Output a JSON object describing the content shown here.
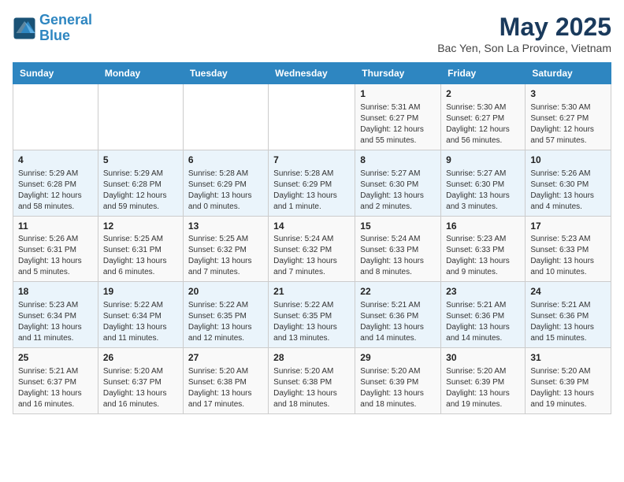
{
  "header": {
    "logo_line1": "General",
    "logo_line2": "Blue",
    "title": "May 2025",
    "subtitle": "Bac Yen, Son La Province, Vietnam"
  },
  "days_of_week": [
    "Sunday",
    "Monday",
    "Tuesday",
    "Wednesday",
    "Thursday",
    "Friday",
    "Saturday"
  ],
  "weeks": [
    [
      {
        "num": "",
        "info": ""
      },
      {
        "num": "",
        "info": ""
      },
      {
        "num": "",
        "info": ""
      },
      {
        "num": "",
        "info": ""
      },
      {
        "num": "1",
        "info": "Sunrise: 5:31 AM\nSunset: 6:27 PM\nDaylight: 12 hours\nand 55 minutes."
      },
      {
        "num": "2",
        "info": "Sunrise: 5:30 AM\nSunset: 6:27 PM\nDaylight: 12 hours\nand 56 minutes."
      },
      {
        "num": "3",
        "info": "Sunrise: 5:30 AM\nSunset: 6:27 PM\nDaylight: 12 hours\nand 57 minutes."
      }
    ],
    [
      {
        "num": "4",
        "info": "Sunrise: 5:29 AM\nSunset: 6:28 PM\nDaylight: 12 hours\nand 58 minutes."
      },
      {
        "num": "5",
        "info": "Sunrise: 5:29 AM\nSunset: 6:28 PM\nDaylight: 12 hours\nand 59 minutes."
      },
      {
        "num": "6",
        "info": "Sunrise: 5:28 AM\nSunset: 6:29 PM\nDaylight: 13 hours\nand 0 minutes."
      },
      {
        "num": "7",
        "info": "Sunrise: 5:28 AM\nSunset: 6:29 PM\nDaylight: 13 hours\nand 1 minute."
      },
      {
        "num": "8",
        "info": "Sunrise: 5:27 AM\nSunset: 6:30 PM\nDaylight: 13 hours\nand 2 minutes."
      },
      {
        "num": "9",
        "info": "Sunrise: 5:27 AM\nSunset: 6:30 PM\nDaylight: 13 hours\nand 3 minutes."
      },
      {
        "num": "10",
        "info": "Sunrise: 5:26 AM\nSunset: 6:30 PM\nDaylight: 13 hours\nand 4 minutes."
      }
    ],
    [
      {
        "num": "11",
        "info": "Sunrise: 5:26 AM\nSunset: 6:31 PM\nDaylight: 13 hours\nand 5 minutes."
      },
      {
        "num": "12",
        "info": "Sunrise: 5:25 AM\nSunset: 6:31 PM\nDaylight: 13 hours\nand 6 minutes."
      },
      {
        "num": "13",
        "info": "Sunrise: 5:25 AM\nSunset: 6:32 PM\nDaylight: 13 hours\nand 7 minutes."
      },
      {
        "num": "14",
        "info": "Sunrise: 5:24 AM\nSunset: 6:32 PM\nDaylight: 13 hours\nand 7 minutes."
      },
      {
        "num": "15",
        "info": "Sunrise: 5:24 AM\nSunset: 6:33 PM\nDaylight: 13 hours\nand 8 minutes."
      },
      {
        "num": "16",
        "info": "Sunrise: 5:23 AM\nSunset: 6:33 PM\nDaylight: 13 hours\nand 9 minutes."
      },
      {
        "num": "17",
        "info": "Sunrise: 5:23 AM\nSunset: 6:33 PM\nDaylight: 13 hours\nand 10 minutes."
      }
    ],
    [
      {
        "num": "18",
        "info": "Sunrise: 5:23 AM\nSunset: 6:34 PM\nDaylight: 13 hours\nand 11 minutes."
      },
      {
        "num": "19",
        "info": "Sunrise: 5:22 AM\nSunset: 6:34 PM\nDaylight: 13 hours\nand 11 minutes."
      },
      {
        "num": "20",
        "info": "Sunrise: 5:22 AM\nSunset: 6:35 PM\nDaylight: 13 hours\nand 12 minutes."
      },
      {
        "num": "21",
        "info": "Sunrise: 5:22 AM\nSunset: 6:35 PM\nDaylight: 13 hours\nand 13 minutes."
      },
      {
        "num": "22",
        "info": "Sunrise: 5:21 AM\nSunset: 6:36 PM\nDaylight: 13 hours\nand 14 minutes."
      },
      {
        "num": "23",
        "info": "Sunrise: 5:21 AM\nSunset: 6:36 PM\nDaylight: 13 hours\nand 14 minutes."
      },
      {
        "num": "24",
        "info": "Sunrise: 5:21 AM\nSunset: 6:36 PM\nDaylight: 13 hours\nand 15 minutes."
      }
    ],
    [
      {
        "num": "25",
        "info": "Sunrise: 5:21 AM\nSunset: 6:37 PM\nDaylight: 13 hours\nand 16 minutes."
      },
      {
        "num": "26",
        "info": "Sunrise: 5:20 AM\nSunset: 6:37 PM\nDaylight: 13 hours\nand 16 minutes."
      },
      {
        "num": "27",
        "info": "Sunrise: 5:20 AM\nSunset: 6:38 PM\nDaylight: 13 hours\nand 17 minutes."
      },
      {
        "num": "28",
        "info": "Sunrise: 5:20 AM\nSunset: 6:38 PM\nDaylight: 13 hours\nand 18 minutes."
      },
      {
        "num": "29",
        "info": "Sunrise: 5:20 AM\nSunset: 6:39 PM\nDaylight: 13 hours\nand 18 minutes."
      },
      {
        "num": "30",
        "info": "Sunrise: 5:20 AM\nSunset: 6:39 PM\nDaylight: 13 hours\nand 19 minutes."
      },
      {
        "num": "31",
        "info": "Sunrise: 5:20 AM\nSunset: 6:39 PM\nDaylight: 13 hours\nand 19 minutes."
      }
    ]
  ]
}
